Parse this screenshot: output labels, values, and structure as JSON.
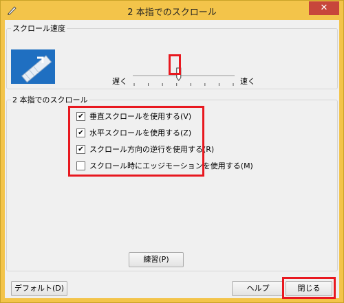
{
  "window": {
    "title": "2 本指でのスクロール",
    "close_glyph": "✕"
  },
  "speed_group": {
    "legend": "スクロール速度",
    "slow_label": "遅く",
    "fast_label": "速く",
    "slider_position_fraction": 0.45,
    "slider_tick_count": 8
  },
  "scroll_group": {
    "legend": "2 本指でのスクロール",
    "options": [
      {
        "label": "垂直スクロールを使用する(V)",
        "checked": true
      },
      {
        "label": "水平スクロールを使用する(Z)",
        "checked": true
      },
      {
        "label": "スクロール方向の逆行を使用する(R)",
        "checked": true
      },
      {
        "label": "スクロール時にエッジモーションを使用する(M)",
        "checked": false
      }
    ]
  },
  "buttons": {
    "practice": "練習(P)",
    "default": "デフォルト(D)",
    "help": "ヘルプ",
    "close": "閉じる"
  },
  "colors": {
    "highlight": "#e8181f",
    "titlebar": "#f3c44a",
    "close_button": "#c7463b"
  }
}
